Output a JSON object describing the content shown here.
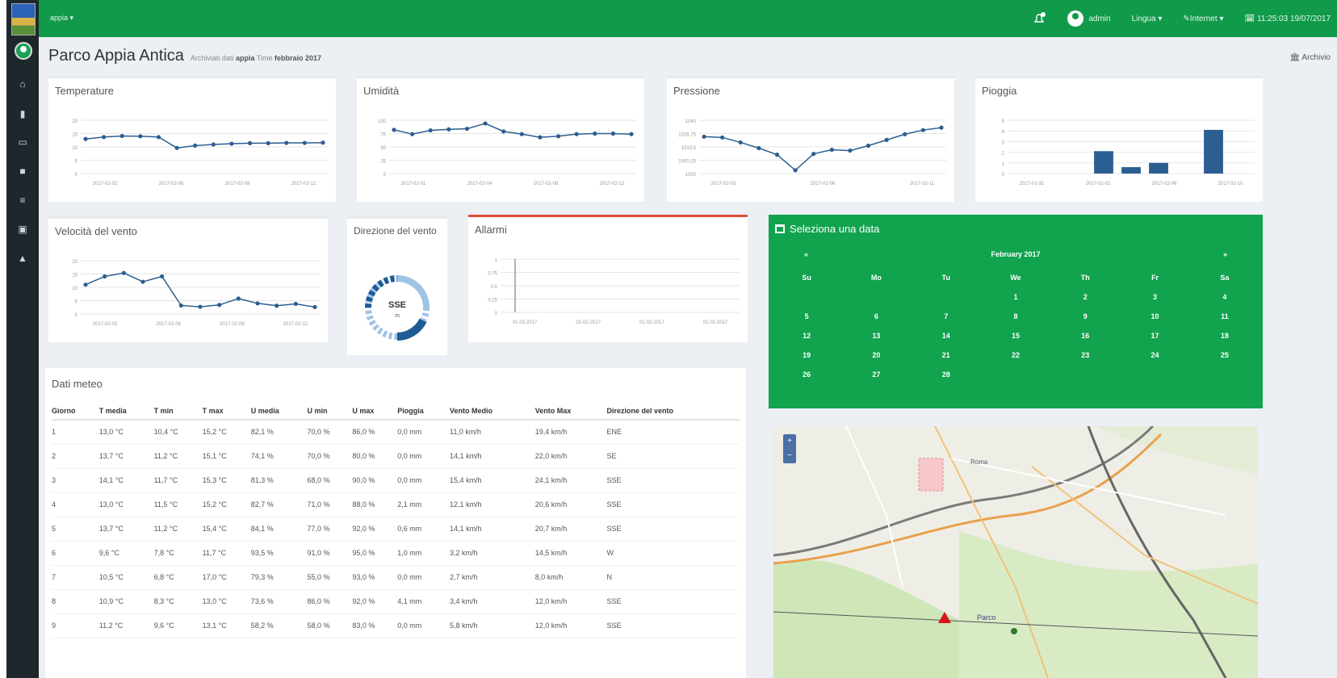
{
  "topbar": {
    "app_menu": "appia ▾",
    "user": "admin",
    "lingua": "Lingua ▾",
    "internet": "✎Internet ▾",
    "clock": "🗓 11:25:03 19/07/2017"
  },
  "page": {
    "title": "Parco Appia Antica",
    "meta_prefix": "Archiviati dati",
    "meta_station": "appia",
    "meta_time_prefix": "Time",
    "meta_time": "febbraio 2017",
    "archive_link": "🏛 Archivio"
  },
  "cards": {
    "temperature": "Temperature",
    "humidity": "Umidità",
    "pressure": "Pressione",
    "rain": "Pioggia",
    "wind_speed": "Velocità del vento",
    "wind_dir": "Direzione del vento",
    "alarms": "Allarmi"
  },
  "wind": {
    "direction": "SSE",
    "sub": "m"
  },
  "calendar": {
    "header": "Seleziona una data",
    "month": "February 2017",
    "prev": "«",
    "next": "»",
    "weekdays": [
      "Su",
      "Mo",
      "Tu",
      "We",
      "Th",
      "Fr",
      "Sa"
    ],
    "days": [
      "",
      "",
      "",
      "1",
      "2",
      "3",
      "4",
      "5",
      "6",
      "7",
      "8",
      "9",
      "10",
      "11",
      "12",
      "13",
      "14",
      "15",
      "16",
      "17",
      "18",
      "19",
      "20",
      "21",
      "22",
      "23",
      "24",
      "25",
      "26",
      "27",
      "28",
      "",
      "",
      "",
      ""
    ]
  },
  "table": {
    "title": "Dati meteo",
    "headers": [
      "Giorno",
      "T media",
      "T min",
      "T max",
      "U media",
      "U min",
      "U max",
      "Pioggia",
      "Vento Medio",
      "Vento Max",
      "Direzione del vento"
    ],
    "rows": [
      [
        "1",
        "13,0 °C",
        "10,4 °C",
        "15,2 °C",
        "82,1 %",
        "70,0 %",
        "86,0 %",
        "0,0 mm",
        "11,0 km/h",
        "19,4 km/h",
        "ENE"
      ],
      [
        "2",
        "13,7 °C",
        "11,2 °C",
        "15,1 °C",
        "74,1 %",
        "70,0 %",
        "80,0 %",
        "0,0 mm",
        "14,1 km/h",
        "22,0 km/h",
        "SE"
      ],
      [
        "3",
        "14,1 °C",
        "11,7 °C",
        "15,3 °C",
        "81,3 %",
        "68,0 %",
        "90,0 %",
        "0,0 mm",
        "15,4 km/h",
        "24,1 km/h",
        "SSE"
      ],
      [
        "4",
        "13,0 °C",
        "11,5 °C",
        "15,2 °C",
        "82,7 %",
        "71,0 %",
        "88,0 %",
        "2,1 mm",
        "12,1 km/h",
        "20,6 km/h",
        "SSE"
      ],
      [
        "5",
        "13,7 °C",
        "11,2 °C",
        "15,4 °C",
        "84,1 %",
        "77,0 %",
        "92,0 %",
        "0,6 mm",
        "14,1 km/h",
        "20,7 km/h",
        "SSE"
      ],
      [
        "6",
        "9,6 °C",
        "7,8 °C",
        "11,7 °C",
        "93,5 %",
        "91,0 %",
        "95,0 %",
        "1,0 mm",
        "3,2 km/h",
        "14,5 km/h",
        "W"
      ],
      [
        "7",
        "10,5 °C",
        "6,8 °C",
        "17,0 °C",
        "79,3 %",
        "55,0 %",
        "93,0 %",
        "0,0 mm",
        "2,7 km/h",
        "8,0 km/h",
        "N"
      ],
      [
        "8",
        "10,9 °C",
        "8,3 °C",
        "13,0 °C",
        "73,6 %",
        "86,0 %",
        "92,0 %",
        "4,1 mm",
        "3,4 km/h",
        "12,0 km/h",
        "SSE"
      ],
      [
        "9",
        "11,2 °C",
        "9,6 °C",
        "13,1 °C",
        "58,2 %",
        "58,0 %",
        "83,0 %",
        "0,0 mm",
        "5,8 km/h",
        "12,0 km/h",
        "SSE"
      ]
    ]
  },
  "map": {
    "labels": [
      "Roma",
      "Parco"
    ],
    "zoom_in": "+",
    "zoom_out": "−"
  },
  "colors": {
    "topbar": "#109a4a",
    "sidebar": "#1e282c",
    "series": "#2c5e91",
    "calendar": "#11a34e",
    "alarm": "#dd4b39"
  },
  "chart_data": [
    {
      "type": "line",
      "title": "Temperature",
      "x": [
        "2017-02-01",
        "2017-02-02",
        "2017-02-03",
        "2017-02-04",
        "2017-02-05",
        "2017-02-06",
        "2017-02-07",
        "2017-02-08",
        "2017-02-09",
        "2017-02-10",
        "2017-02-11",
        "2017-02-12",
        "2017-02-13",
        "2017-02-14"
      ],
      "xticks": [
        "2017-02-02",
        "2017-02-06",
        "2017-02-09",
        "2017-02-12"
      ],
      "yticks": [
        "20",
        "15",
        "10",
        "5",
        "0"
      ],
      "ylim": [
        0,
        20
      ],
      "values": [
        13.0,
        13.7,
        14.1,
        14.0,
        13.7,
        9.6,
        10.5,
        10.9,
        11.2,
        11.4,
        11.4,
        11.5,
        11.5,
        11.6
      ]
    },
    {
      "type": "line",
      "title": "Umidità",
      "x": [
        "2017-02-01",
        "2017-02-02",
        "2017-02-03",
        "2017-02-04",
        "2017-02-05",
        "2017-02-06",
        "2017-02-07",
        "2017-02-08",
        "2017-02-09",
        "2017-02-10",
        "2017-02-11",
        "2017-02-12",
        "2017-02-13",
        "2017-02-14"
      ],
      "xticks": [
        "2017-02-01",
        "2017-02-04",
        "2017-02-08",
        "2017-02-12"
      ],
      "yticks": [
        "100",
        "75",
        "50",
        "25",
        "0"
      ],
      "ylim": [
        0,
        100
      ],
      "values": [
        82,
        74,
        81,
        83,
        84,
        94,
        79,
        74,
        68,
        70,
        74,
        75,
        75,
        74
      ]
    },
    {
      "type": "line",
      "title": "Pressione",
      "x": [
        "2017-02-01",
        "2017-02-02",
        "2017-02-03",
        "2017-02-04",
        "2017-02-05",
        "2017-02-06",
        "2017-02-07",
        "2017-02-08",
        "2017-02-09",
        "2017-02-10",
        "2017-02-11",
        "2017-02-12",
        "2017-02-13",
        "2017-02-14"
      ],
      "xticks": [
        "2017-02-03",
        "2017-02-06",
        "2017-02-11"
      ],
      "yticks": [
        "1040",
        "1026.75",
        "1013.5",
        "1000.25",
        "1000"
      ],
      "ylim": [
        980,
        1045
      ],
      "values": [
        1025,
        1024,
        1018,
        1011,
        1003,
        984,
        1004,
        1009,
        1008,
        1014,
        1021,
        1028,
        1033,
        1036
      ]
    },
    {
      "type": "bar",
      "title": "Pioggia",
      "categories": [
        "2017-02-01",
        "2017-02-02",
        "2017-02-03",
        "2017-02-04",
        "2017-02-05",
        "2017-02-06",
        "2017-02-07",
        "2017-02-08",
        "2017-02-09"
      ],
      "xticks": [
        "2017-01-31",
        "2017-02-02",
        "2017-02-06",
        "2017-02-10"
      ],
      "yticks": [
        "5",
        "4",
        "3",
        "2",
        "1",
        "0"
      ],
      "ylim": [
        0,
        5
      ],
      "values": [
        0,
        0,
        0,
        2.1,
        0.6,
        1.0,
        0,
        4.1,
        0
      ]
    },
    {
      "type": "line",
      "title": "Velocità del vento",
      "x": [
        "2017-02-01",
        "2017-02-02",
        "2017-02-03",
        "2017-02-04",
        "2017-02-05",
        "2017-02-06",
        "2017-02-07",
        "2017-02-08",
        "2017-02-09",
        "2017-02-10",
        "2017-02-11",
        "2017-02-12",
        "2017-02-13"
      ],
      "xticks": [
        "2017-02-03",
        "2017-02-06",
        "2017-02-09",
        "2017-02-12"
      ],
      "yticks": [
        "20",
        "15",
        "10",
        "5",
        "0"
      ],
      "ylim": [
        0,
        20
      ],
      "values": [
        11.0,
        14.1,
        15.4,
        12.1,
        14.1,
        3.2,
        2.7,
        3.4,
        5.8,
        4.0,
        3.1,
        3.8,
        2.6
      ]
    },
    {
      "type": "line",
      "title": "Allarmi",
      "xticks": [
        "01-02-2017",
        "01-02-2017",
        "01-02-2017",
        "01-02-2017"
      ],
      "yticks": [
        "1",
        "0.75",
        "0.5",
        "0.25",
        "0"
      ],
      "ylim": [
        0,
        1
      ],
      "values": []
    }
  ]
}
